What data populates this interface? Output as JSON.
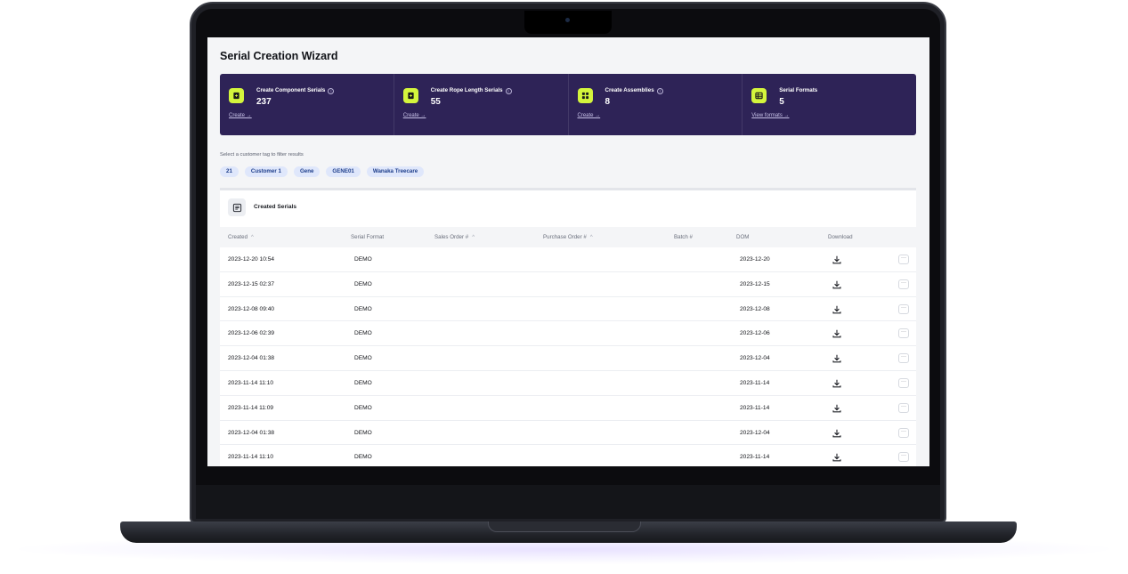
{
  "app": {
    "title": "Serial Creation Wizard"
  },
  "stats": [
    {
      "label": "Create Component Serials",
      "value": "237",
      "link": "Create →",
      "icon": "file-plus-icon",
      "has_info": true
    },
    {
      "label": "Create Rope Length Serials",
      "value": "55",
      "link": "Create →",
      "icon": "file-plus-icon",
      "has_info": true
    },
    {
      "label": "Create Assemblies",
      "value": "8",
      "link": "Create →",
      "icon": "grid-icon",
      "has_info": true
    },
    {
      "label": "Serial Formats",
      "value": "5",
      "link": "View formats →",
      "icon": "table-icon",
      "has_info": false
    }
  ],
  "colors": {
    "banner": "#2e2357",
    "accent": "#d4f53c",
    "tag_bg": "#dfe7fb",
    "tag_text": "#1f3f8c"
  },
  "filter": {
    "label": "Select a customer tag to filter results",
    "tags": [
      "21",
      "Customer 1",
      "Gene",
      "GENE01",
      "Wanaka Treecare"
    ]
  },
  "table": {
    "title": "Created Serials",
    "columns": [
      "Created",
      "Serial Format",
      "Sales Order #",
      "Purchase Order #",
      "Batch #",
      "DOM",
      "Download"
    ],
    "rows": [
      {
        "created": "2023-12-20 10:54",
        "format": "DEMO",
        "dom": "2023-12-20"
      },
      {
        "created": "2023-12-15 02:37",
        "format": "DEMO",
        "dom": "2023-12-15"
      },
      {
        "created": "2023-12-08 09:40",
        "format": "DEMO",
        "dom": "2023-12-08"
      },
      {
        "created": "2023-12-06 02:39",
        "format": "DEMO",
        "dom": "2023-12-06"
      },
      {
        "created": "2023-12-04 01:38",
        "format": "DEMO",
        "dom": "2023-12-04"
      },
      {
        "created": "2023-11-14 11:10",
        "format": "DEMO",
        "dom": "2023-11-14"
      },
      {
        "created": "2023-11-14 11:09",
        "format": "DEMO",
        "dom": "2023-11-14"
      },
      {
        "created": "2023-12-04 01:38",
        "format": "DEMO",
        "dom": "2023-12-04"
      },
      {
        "created": "2023-11-14 11:10",
        "format": "DEMO",
        "dom": "2023-11-14"
      }
    ]
  }
}
